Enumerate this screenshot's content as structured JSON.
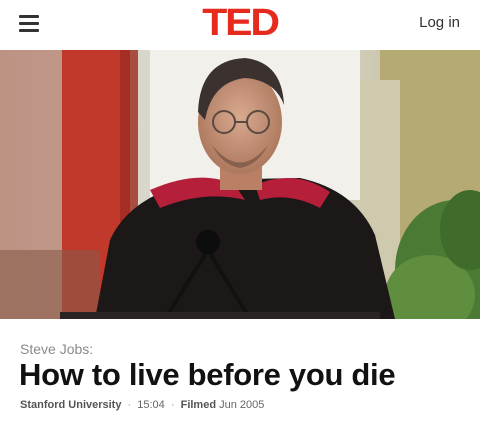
{
  "header": {
    "logo_text": "TED",
    "login_label": "Log in",
    "menu_icon": "hamburger-menu-icon"
  },
  "video": {
    "description_icon": "video-still"
  },
  "talk": {
    "speaker": "Steve Jobs:",
    "title": "How to live before you die",
    "event": "Stanford University",
    "separator": "·",
    "duration": "15:04",
    "filmed_label": "Filmed",
    "filmed_date": "Jun 2005"
  },
  "colors": {
    "brand": "#e62b1e",
    "text_dark": "#111111",
    "text_muted": "#8a8a8a"
  }
}
